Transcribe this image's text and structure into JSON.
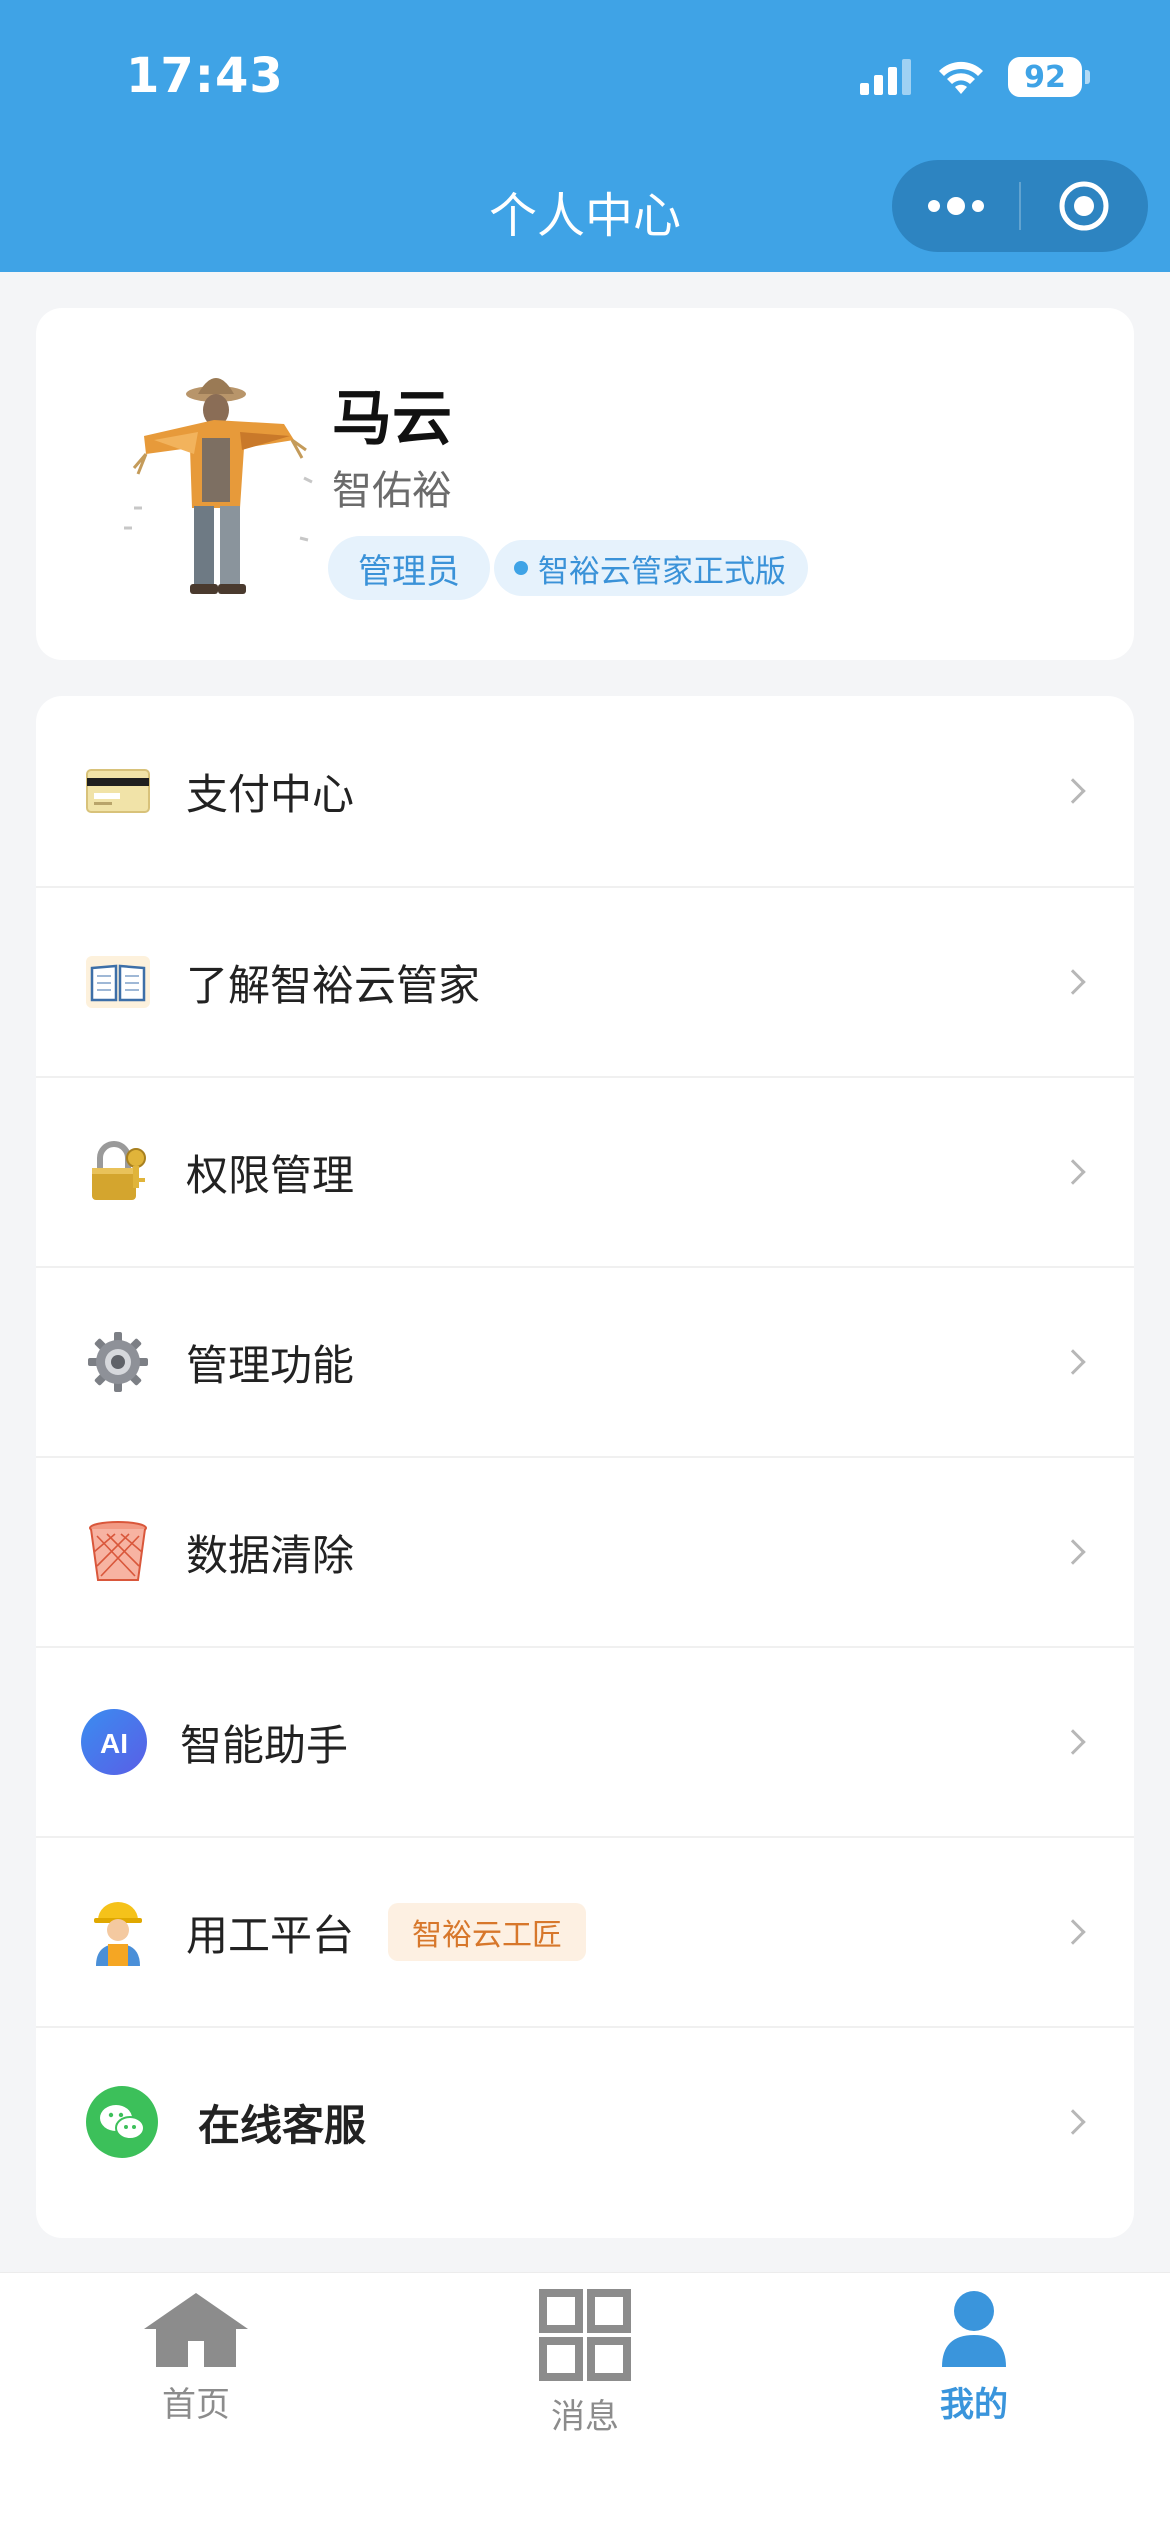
{
  "status_bar": {
    "time": "17:43",
    "battery": "92"
  },
  "nav": {
    "title": "个人中心"
  },
  "profile": {
    "name": "马云",
    "company": "智佑裕",
    "role_tag": "管理员",
    "edition_tag": "智裕云管家正式版"
  },
  "menu": {
    "items": [
      {
        "label": "支付中心",
        "icon": "credit-card-icon"
      },
      {
        "label": "了解智裕云管家",
        "icon": "book-icon"
      },
      {
        "label": "权限管理",
        "icon": "lock-key-icon"
      },
      {
        "label": "管理功能",
        "icon": "gear-icon"
      },
      {
        "label": "数据清除",
        "icon": "wastebasket-icon"
      },
      {
        "label": "智能助手",
        "icon": "ai-icon",
        "icon_text": "AI"
      },
      {
        "label": "用工平台",
        "icon": "worker-icon",
        "badge": "智裕云工匠"
      },
      {
        "label": "在线客服",
        "icon": "wechat-icon"
      }
    ]
  },
  "tabbar": {
    "items": [
      {
        "label": "首页",
        "icon": "home-icon"
      },
      {
        "label": "消息",
        "icon": "grid-icon"
      },
      {
        "label": "我的",
        "icon": "user-icon",
        "active": true
      }
    ]
  },
  "colors": {
    "primary": "#3fa3e6",
    "tag_bg": "#e6f2fc",
    "badge_orange": "#d7772b"
  }
}
